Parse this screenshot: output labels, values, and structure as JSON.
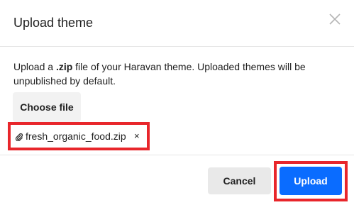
{
  "dialog": {
    "title": "Upload theme",
    "description_prefix": "Upload a ",
    "description_bold": ".zip",
    "description_suffix": " file of your Haravan theme. Uploaded themes will be unpublished by default.",
    "choose_file_label": "Choose file",
    "file": {
      "name": "fresh_organic_food.zip",
      "remove_symbol": "×"
    },
    "cancel_label": "Cancel",
    "upload_label": "Upload"
  },
  "icons": {
    "close": "close-icon",
    "attachment": "paperclip-icon"
  },
  "colors": {
    "primary": "#0a6cff",
    "highlight": "#e8262b",
    "secondary_button": "#e9e9e9"
  }
}
